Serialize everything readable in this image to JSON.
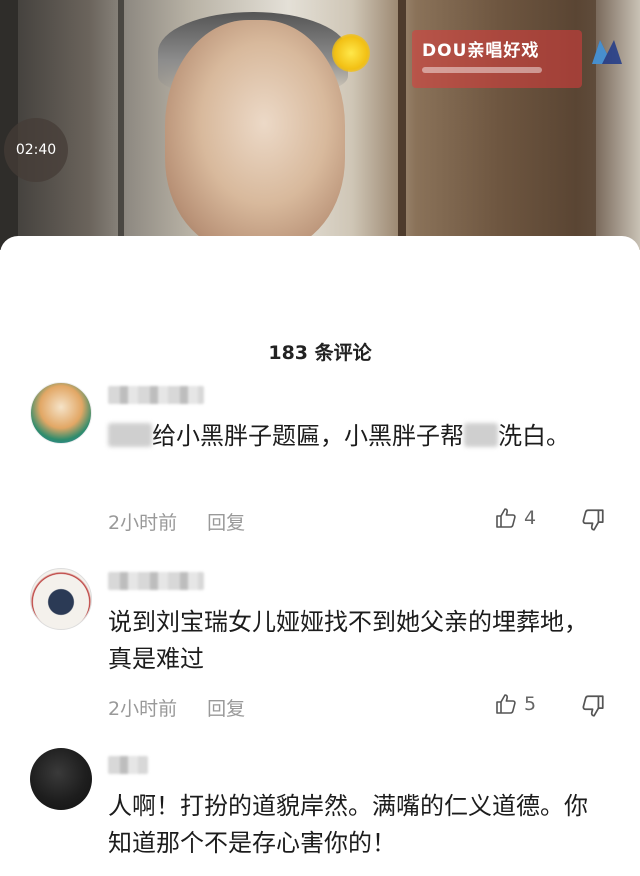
{
  "video": {
    "timer": "02:40",
    "watermark": "DOU亲唱好戏"
  },
  "sheet": {
    "comment_count": "183 条评论"
  },
  "comments": [
    {
      "text_prefix": "给小黑胖子题匾，小黑胖子帮",
      "text_suffix": "洗白。",
      "time": "2小时前",
      "reply_label": "回复",
      "likes": "4"
    },
    {
      "text": "说到刘宝瑞女儿娅娅找不到她父亲的埋葬地，真是难过",
      "time": "2小时前",
      "reply_label": "回复",
      "likes": "5"
    },
    {
      "text": "人啊！打扮的道貌岸然。满嘴的仁义道德。你知道那个不是存心害你的！"
    }
  ],
  "colors": {
    "meta": "#999999",
    "text": "#1c1c1c",
    "watermark_bg": "#dc3c3c"
  }
}
